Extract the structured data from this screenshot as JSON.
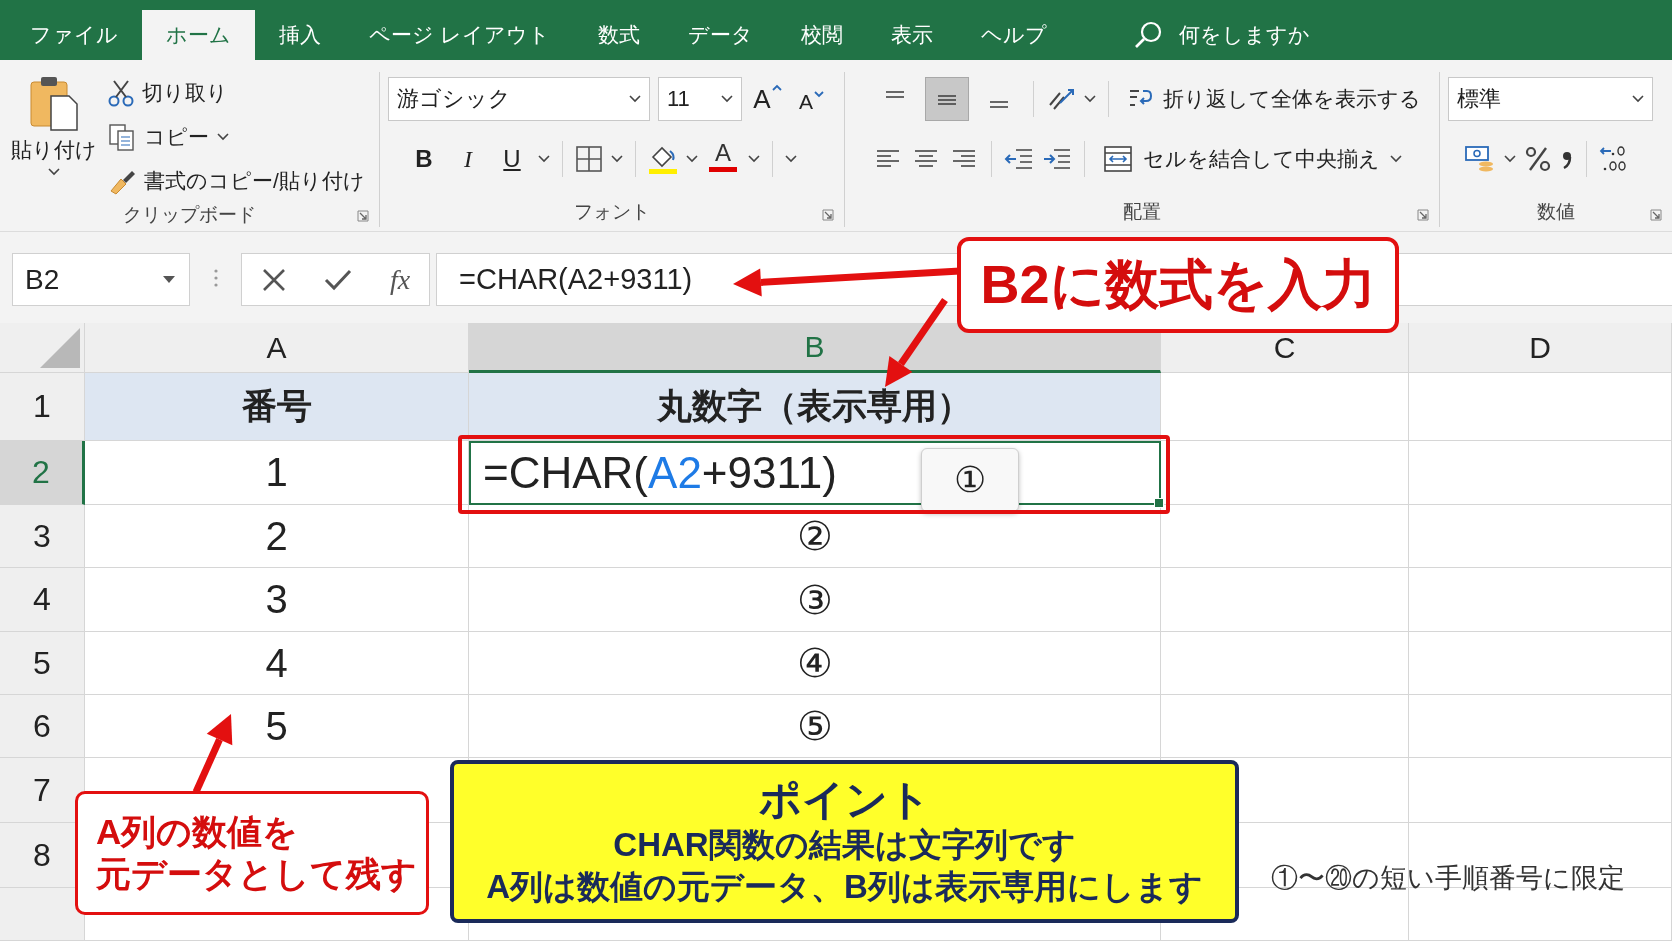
{
  "ribbon_tabs": [
    {
      "label": "ファイル",
      "selected": false
    },
    {
      "label": "ホーム",
      "selected": true
    },
    {
      "label": "挿入",
      "selected": false
    },
    {
      "label": "ページ レイアウト",
      "selected": false
    },
    {
      "label": "数式",
      "selected": false
    },
    {
      "label": "データ",
      "selected": false
    },
    {
      "label": "校閲",
      "selected": false
    },
    {
      "label": "表示",
      "selected": false
    },
    {
      "label": "ヘルプ",
      "selected": false
    }
  ],
  "tell_me": {
    "placeholder": "何をしますか"
  },
  "clipboard": {
    "paste": "貼り付け",
    "cut": "切り取り",
    "copy": "コピー",
    "format_painter": "書式のコピー/貼り付け",
    "group_label": "クリップボード"
  },
  "font": {
    "name": "游ゴシック",
    "size": "11",
    "grow": "A",
    "shrink": "A",
    "styles": [
      {
        "label": "B",
        "kind": "bold"
      },
      {
        "label": "I",
        "kind": "italic"
      },
      {
        "label": "U",
        "kind": "underline"
      }
    ],
    "font_color": "A",
    "group_label": "フォント"
  },
  "alignment": {
    "vertical": [
      {
        "kind": "top",
        "selected": false
      },
      {
        "kind": "middle",
        "selected": true
      },
      {
        "kind": "bottom",
        "selected": false
      }
    ],
    "wrap_text": "折り返して全体を表示する",
    "merge_center": "セルを結合して中央揃え",
    "group_label": "配置"
  },
  "number": {
    "format": "標準",
    "group_label": "数値"
  },
  "formula_bar": {
    "name_box": "B2",
    "fx": "fx",
    "formula": "=CHAR(A2+9311)"
  },
  "columns": [
    {
      "label": "A",
      "selected": false
    },
    {
      "label": "B",
      "selected": true
    },
    {
      "label": "C",
      "selected": false
    },
    {
      "label": "D",
      "selected": false
    }
  ],
  "rows": [
    {
      "number": "1",
      "selected": false,
      "kind": "header",
      "a": "番号",
      "b": "丸数字（表示専用）"
    },
    {
      "number": "2",
      "selected": true,
      "kind": "editing",
      "a": "1",
      "b_parts": [
        {
          "text": "=CHAR(",
          "kind": "plain"
        },
        {
          "text": "A2",
          "kind": "ref"
        },
        {
          "text": "+9311)",
          "kind": "plain"
        }
      ],
      "b_preview": "①"
    },
    {
      "number": "3",
      "selected": false,
      "kind": "data",
      "a": "2",
      "b": "②"
    },
    {
      "number": "4",
      "selected": false,
      "kind": "data",
      "a": "3",
      "b": "③"
    },
    {
      "number": "5",
      "selected": false,
      "kind": "data",
      "a": "4",
      "b": "④"
    },
    {
      "number": "6",
      "selected": false,
      "kind": "data",
      "a": "5",
      "b": "⑤"
    },
    {
      "number": "7",
      "selected": false,
      "kind": "empty"
    },
    {
      "number": "8",
      "selected": false,
      "kind": "empty"
    }
  ],
  "formula_callout": {
    "text": "B2に数式を入力"
  },
  "column_a_callout": {
    "lines": [
      "A列の数値を",
      "元データとして残す"
    ]
  },
  "point_box": {
    "title": "ポイント",
    "lines": [
      "CHAR関数の結果は文字列です",
      "A列は数値の元データ、B列は表示専用にします"
    ]
  },
  "note": "①〜⑳の短い手順番号に限定"
}
